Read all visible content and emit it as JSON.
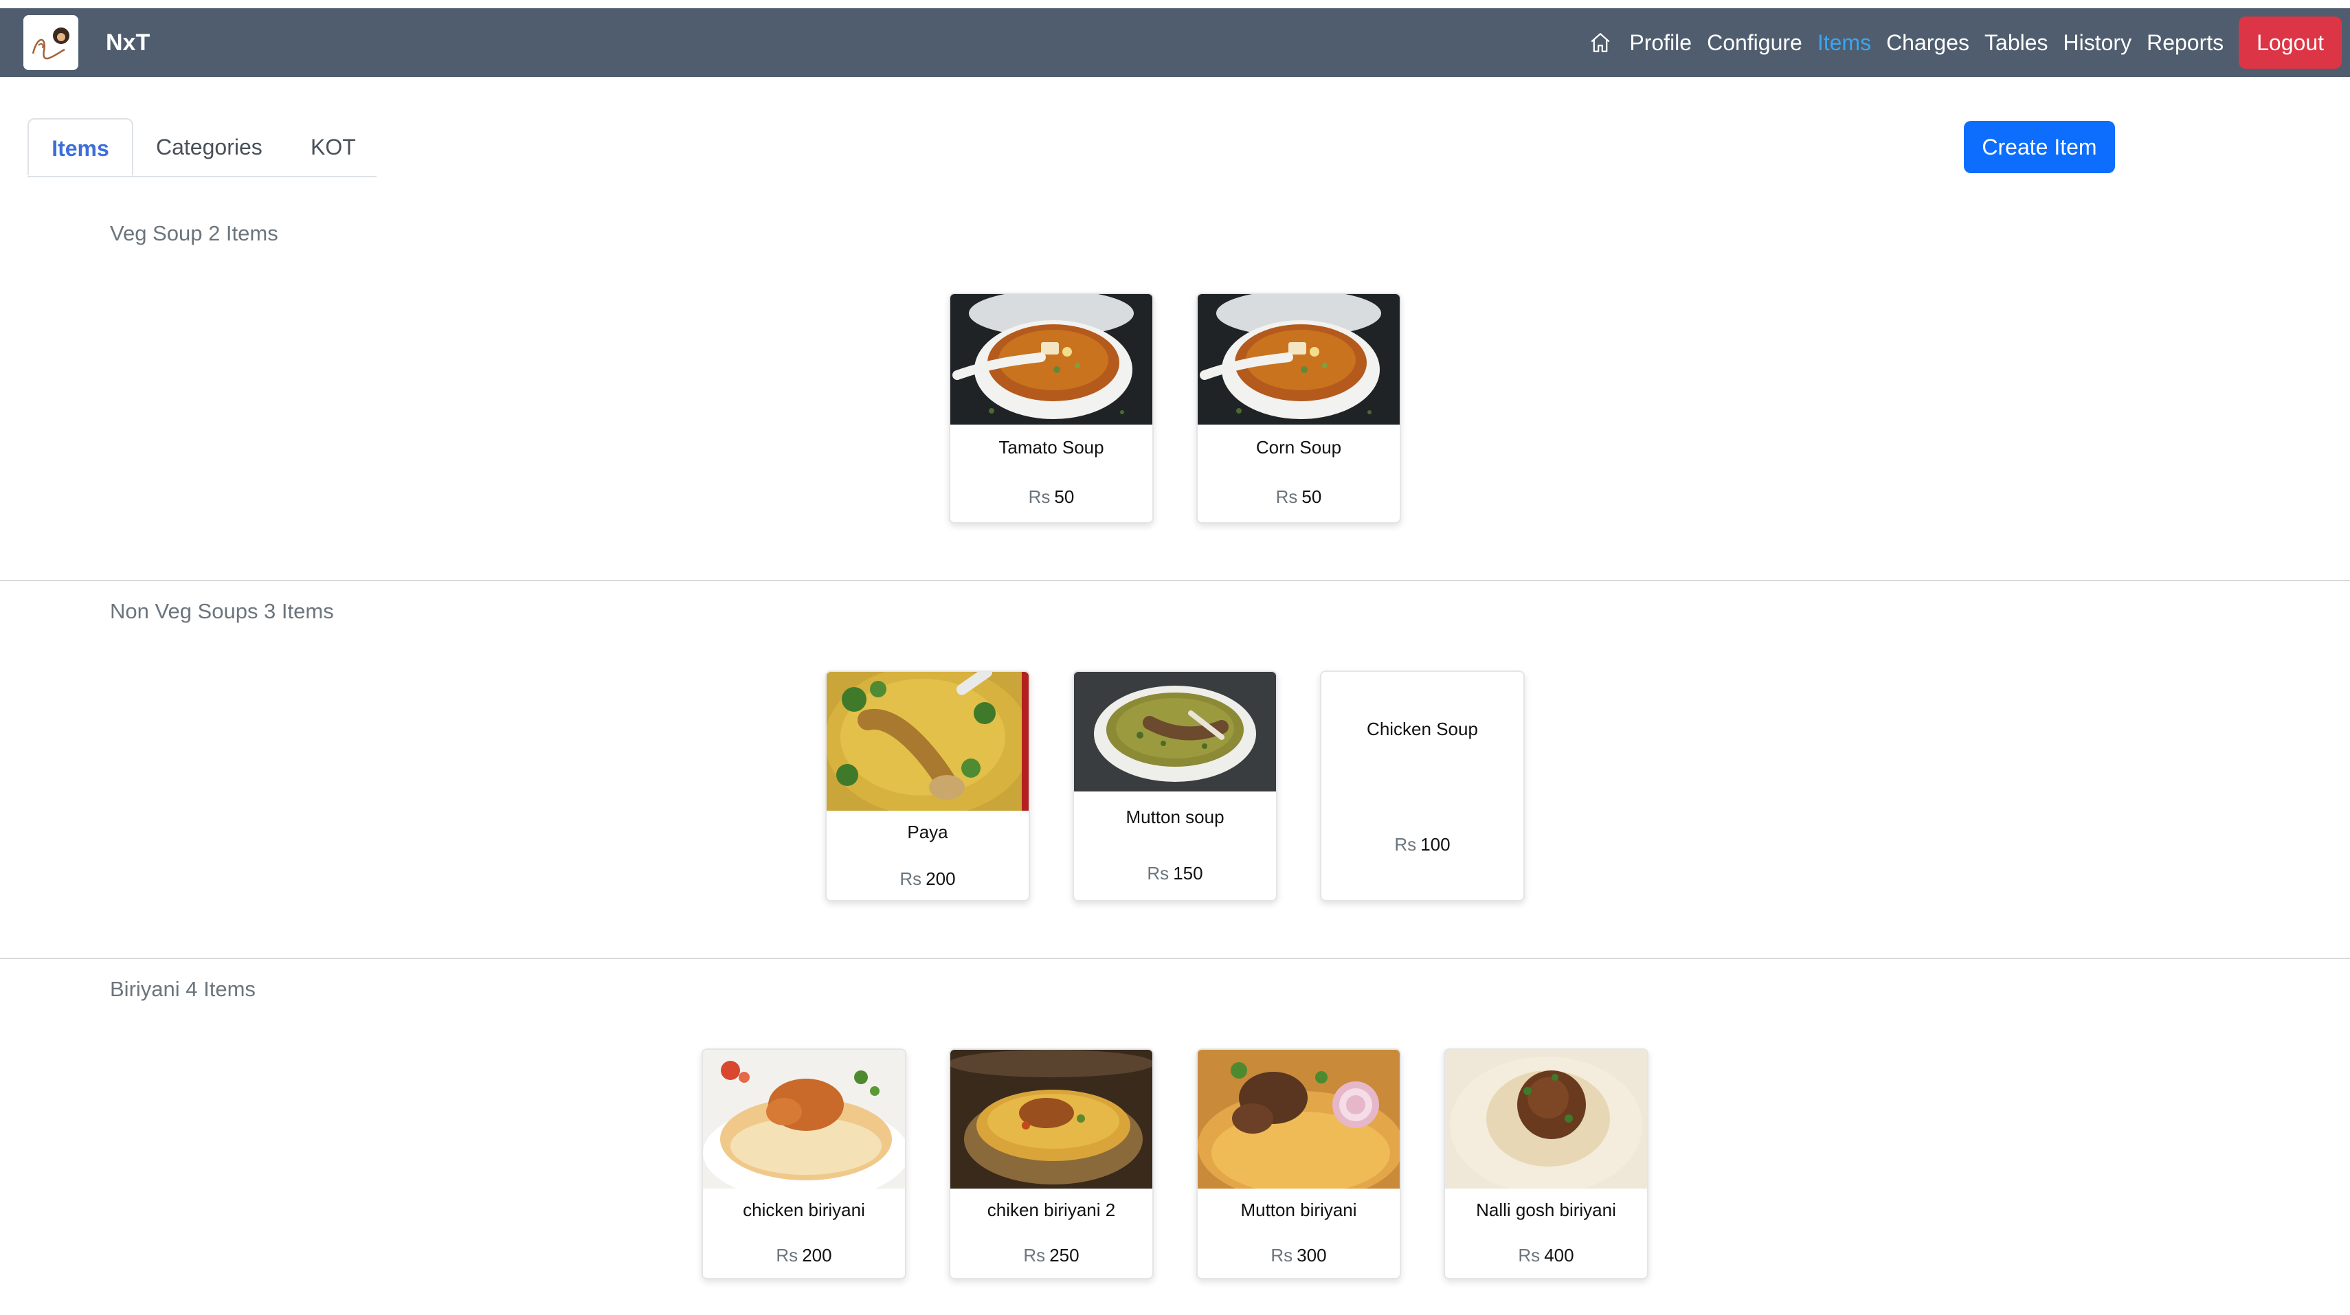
{
  "header": {
    "brand": "NxT",
    "nav": [
      {
        "label": "Profile",
        "active": false
      },
      {
        "label": "Configure",
        "active": false
      },
      {
        "label": "Items",
        "active": true
      },
      {
        "label": "Charges",
        "active": false
      },
      {
        "label": "Tables",
        "active": false
      },
      {
        "label": "History",
        "active": false
      },
      {
        "label": "Reports",
        "active": false
      }
    ],
    "logout_label": "Logout"
  },
  "tabs": [
    {
      "label": "Items",
      "active": true
    },
    {
      "label": "Categories",
      "active": false
    },
    {
      "label": "KOT",
      "active": false
    }
  ],
  "create_label": "Create Item",
  "currency": "Rs",
  "sections": [
    {
      "title": "Veg Soup 2 Items",
      "items": [
        {
          "name": "Tamato Soup",
          "price": "50",
          "photo": "veg-soup"
        },
        {
          "name": "Corn Soup",
          "price": "50",
          "photo": "veg-soup"
        }
      ]
    },
    {
      "title": "Non Veg Soups 3 Items",
      "items": [
        {
          "name": "Paya",
          "price": "200",
          "photo": "paya"
        },
        {
          "name": "Mutton soup",
          "price": "150",
          "photo": "mutton-soup"
        },
        {
          "name": "Chicken Soup",
          "price": "100",
          "photo": "none"
        }
      ]
    },
    {
      "title": "Biriyani 4 Items",
      "items": [
        {
          "name": "chicken biriyani",
          "price": "200",
          "photo": "biriyani-plate"
        },
        {
          "name": "chiken biriyani 2",
          "price": "250",
          "photo": "biriyani-pot"
        },
        {
          "name": "Mutton biriyani",
          "price": "300",
          "photo": "biriyani-mutton"
        },
        {
          "name": "Nalli gosh biriyani",
          "price": "400",
          "photo": "biriyani-nalli"
        }
      ]
    }
  ],
  "colors": {
    "navbar": "#4f5d6e",
    "active_nav": "#3aa6f2",
    "logout": "#dc3545",
    "primary": "#0d6efd"
  }
}
